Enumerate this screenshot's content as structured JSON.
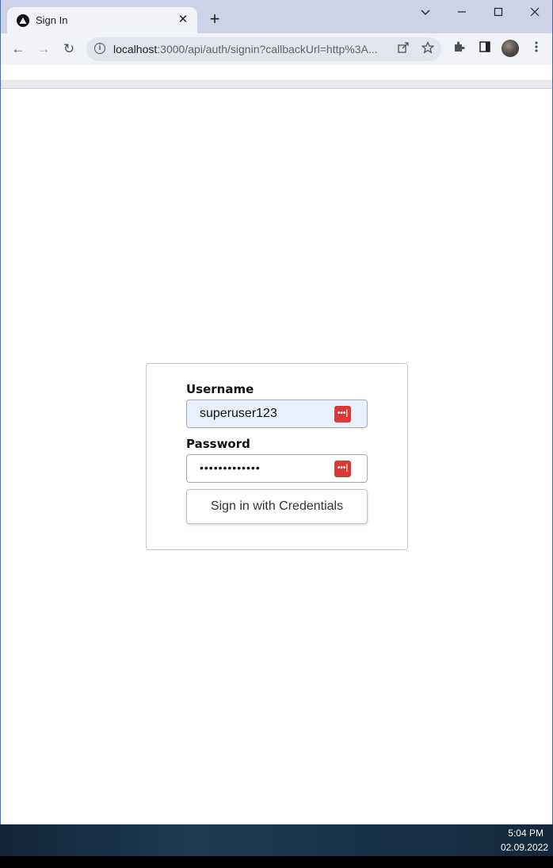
{
  "browser": {
    "tab": {
      "title": "Sign In",
      "favicon": "triangle-logo-icon",
      "close_glyph": "✕"
    },
    "new_tab_glyph": "+",
    "window_controls": {
      "minimize": "—",
      "maximize": "☐",
      "close": "✕",
      "dropdown": "⌄"
    },
    "toolbar": {
      "back": "←",
      "forward": "→",
      "reload": "↻",
      "url_host": "localhost",
      "url_rest": ":3000/api/auth/signin?callbackUrl=http%3A...",
      "icons": [
        "info-icon",
        "share-icon",
        "star-icon",
        "extensions-icon",
        "side-panel-icon",
        "profile-avatar",
        "menu-icon"
      ]
    }
  },
  "signin": {
    "username_label": "Username",
    "username_value": "superuser123",
    "password_label": "Password",
    "password_value": "•••••••••••••",
    "submit_label": "Sign in with Credentials",
    "password_manager_glyph": "•••|"
  },
  "taskbar": {
    "time": "5:04 PM",
    "date": "02.09.2022"
  },
  "colors": {
    "tab_strip": "#cdd2e6",
    "toolbar": "#f1f3f8",
    "autofill": "#e8f0fe",
    "password_manager": "#d93a36"
  }
}
